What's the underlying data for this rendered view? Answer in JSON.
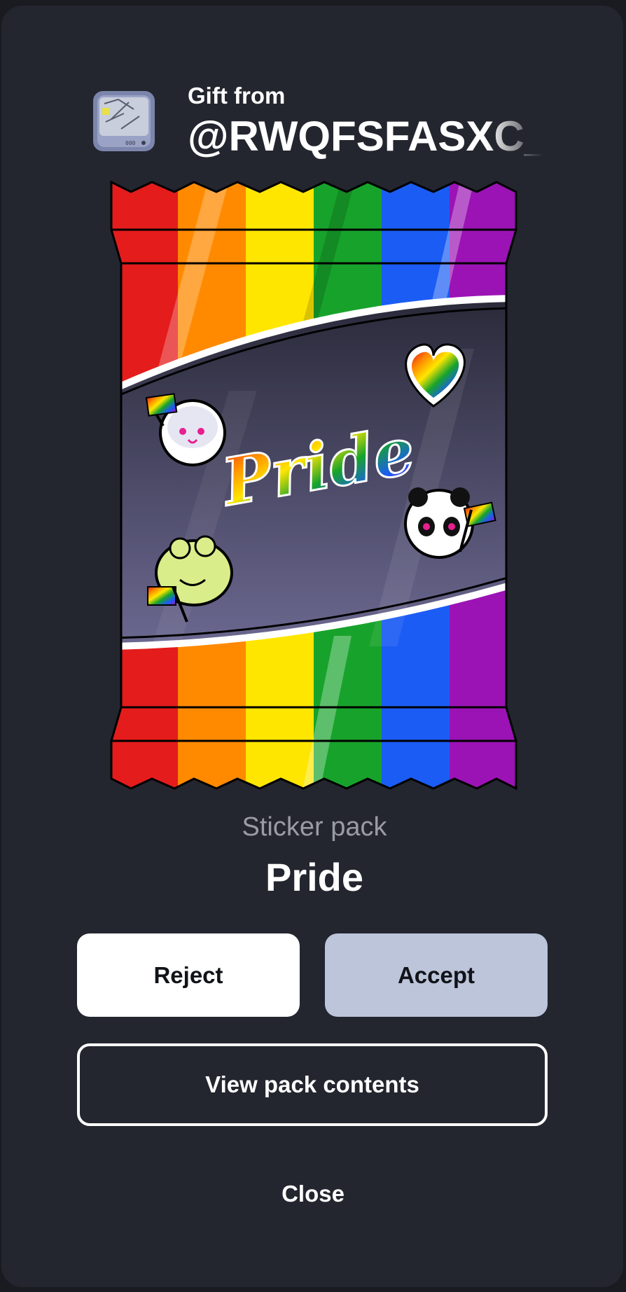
{
  "header": {
    "gift_label": "Gift from",
    "username": "@RWQFSFASXC_N"
  },
  "pack": {
    "type_label": "Sticker pack",
    "name": "Pride",
    "art_text": "Pride",
    "stripe_colors": [
      "#e41c1c",
      "#ff8a00",
      "#ffe600",
      "#17a32b",
      "#1b5cf4",
      "#9b13b5"
    ]
  },
  "actions": {
    "reject": "Reject",
    "accept": "Accept",
    "view_contents": "View pack contents",
    "close": "Close"
  }
}
